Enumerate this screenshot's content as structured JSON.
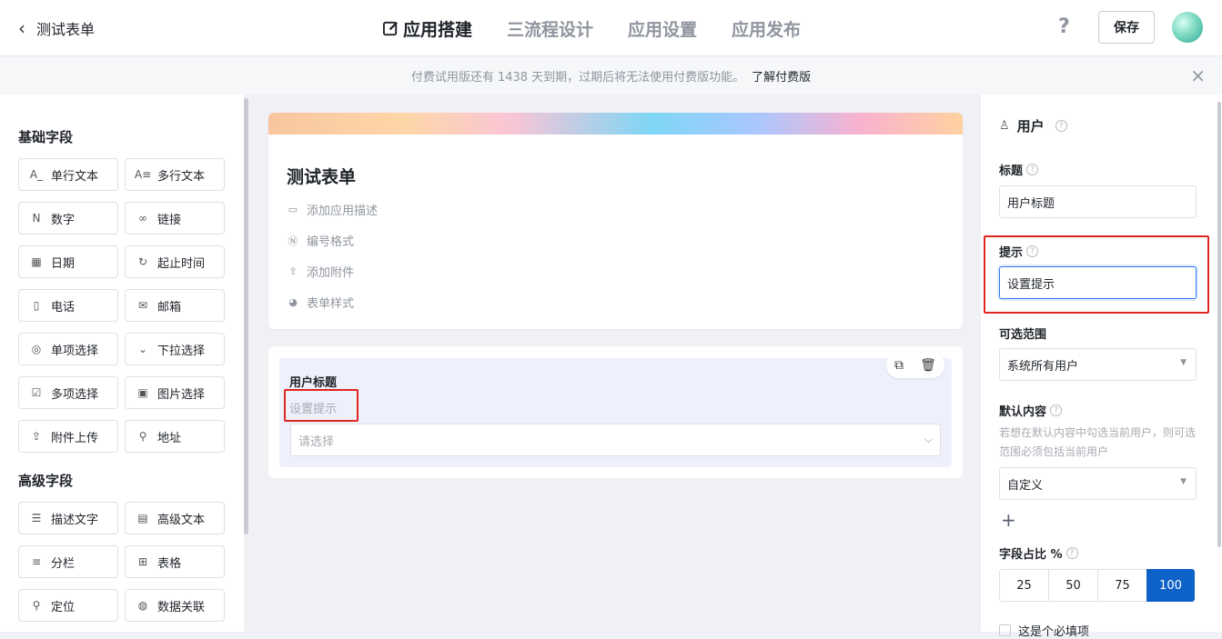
{
  "header": {
    "back_label": "测试表单",
    "tabs": [
      {
        "label": "应用搭建",
        "active": true,
        "icon": "edit-icon"
      },
      {
        "label": "三流程设计",
        "active": false
      },
      {
        "label": "应用设置",
        "active": false
      },
      {
        "label": "应用发布",
        "active": false
      }
    ],
    "help": "?",
    "save_label": "保存"
  },
  "notice": {
    "text": "付费试用版还有 1438 天到期，过期后将无法使用付费版功能。",
    "link": "了解付费版",
    "close": "×"
  },
  "sidebar": {
    "basic_title": "基础字段",
    "basic_fields": [
      {
        "label": "单行文本",
        "icon": "A_"
      },
      {
        "label": "多行文本",
        "icon": "A≡"
      },
      {
        "label": "数字",
        "icon": "N"
      },
      {
        "label": "链接",
        "icon": "∞"
      },
      {
        "label": "日期",
        "icon": "▦"
      },
      {
        "label": "起止时间",
        "icon": "↻"
      },
      {
        "label": "电话",
        "icon": "▯"
      },
      {
        "label": "邮箱",
        "icon": "✉"
      },
      {
        "label": "单项选择",
        "icon": "◎"
      },
      {
        "label": "下拉选择",
        "icon": "⌄"
      },
      {
        "label": "多项选择",
        "icon": "☑"
      },
      {
        "label": "图片选择",
        "icon": "▣"
      },
      {
        "label": "附件上传",
        "icon": "⇪"
      },
      {
        "label": "地址",
        "icon": "⚲"
      }
    ],
    "advanced_title": "高级字段",
    "advanced_fields": [
      {
        "label": "描述文字",
        "icon": "☰"
      },
      {
        "label": "高级文本",
        "icon": "▤"
      },
      {
        "label": "分栏",
        "icon": "≡"
      },
      {
        "label": "表格",
        "icon": "⊞"
      },
      {
        "label": "定位",
        "icon": "⚲"
      },
      {
        "label": "数据关联",
        "icon": "◍"
      }
    ]
  },
  "form": {
    "title": "测试表单",
    "options": [
      {
        "label": "添加应用描述",
        "icon": "💬"
      },
      {
        "label": "编号格式",
        "icon": "N"
      },
      {
        "label": "添加附件",
        "icon": "⇪"
      },
      {
        "label": "表单样式",
        "icon": "◕"
      }
    ],
    "field": {
      "label": "用户标题",
      "hint": "设置提示",
      "placeholder": "请选择"
    }
  },
  "panel": {
    "type_label": "用户",
    "title_label": "标题",
    "title_value": "用户标题",
    "hint_label": "提示",
    "hint_value": "设置提示",
    "range_label": "可选范围",
    "range_value": "系统所有用户",
    "default_label": "默认内容",
    "default_desc": "若想在默认内容中勾选当前用户，则可选范围必须包括当前用户",
    "default_value": "自定义",
    "plus": "+",
    "width_label": "字段占比 %",
    "width_options": [
      "25",
      "50",
      "75",
      "100"
    ],
    "width_selected": "100",
    "cut_label": "这是个必填项"
  },
  "colors": {
    "accent": "#0e62c7",
    "highlight": "#e0251f",
    "focus": "#2e7cf6"
  }
}
